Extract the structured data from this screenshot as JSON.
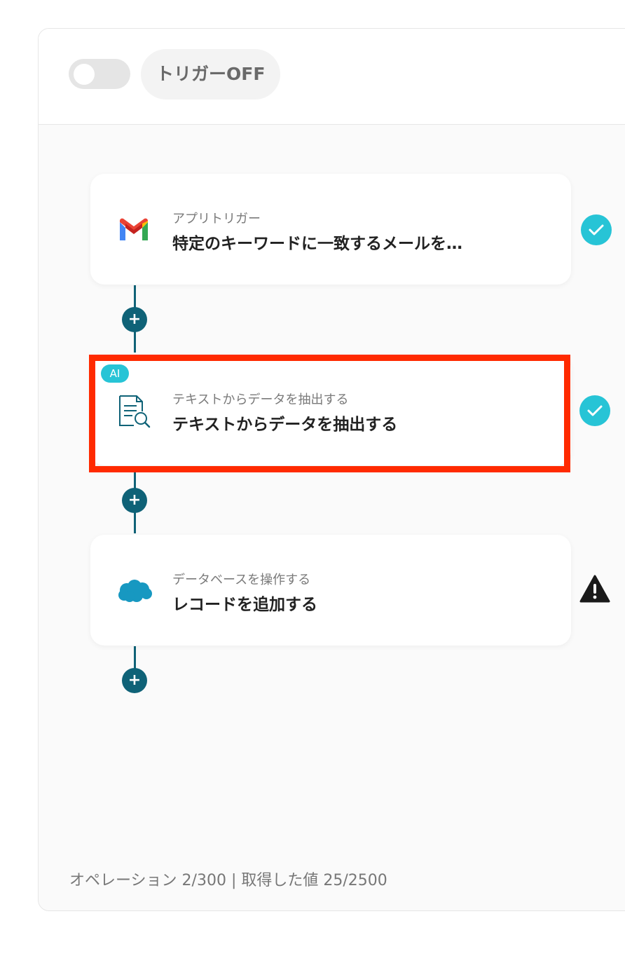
{
  "trigger": {
    "label": "トリガーOFF",
    "enabled": false
  },
  "steps": [
    {
      "subtitle": "アプリトリガー",
      "title": "特定のキーワードに一致するメールを…",
      "icon": "gmail-icon",
      "status": "complete"
    },
    {
      "badge": "AI",
      "subtitle": "テキストからデータを抽出する",
      "title": "テキストからデータを抽出する",
      "icon": "document-search-icon",
      "status": "complete"
    },
    {
      "subtitle": "データベースを操作する",
      "title": "レコードを追加する",
      "icon": "salesforce-cloud-icon",
      "status": "warning"
    }
  ],
  "footer": {
    "usage": "オペレーション 2/300 | 取得した値 25/2500"
  },
  "colors": {
    "connector": "#0f6277",
    "check": "#27c4d6",
    "highlight": "#ff2a00",
    "warning": "#1a1a1a"
  }
}
